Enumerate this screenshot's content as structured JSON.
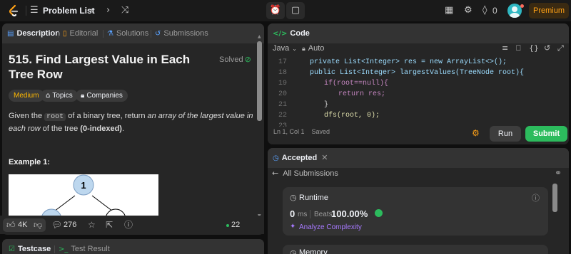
{
  "topnav": {
    "problem_list": "Problem List",
    "streak_count": "0",
    "premium": "Premium",
    "icons": [
      "leetcode-logo",
      "list-icon",
      "chevron-left-icon",
      "chevron-right-icon",
      "shuffle-icon",
      "alarm-icon",
      "note-icon",
      "grid-icon",
      "gear-icon",
      "fire-icon",
      "avatar"
    ]
  },
  "description_panel": {
    "tabs": [
      {
        "label": "Description",
        "active": true,
        "icon": "doc-icon"
      },
      {
        "label": "Editorial",
        "active": false,
        "icon": "book-icon"
      },
      {
        "label": "Solutions",
        "active": false,
        "icon": "flask-icon"
      },
      {
        "label": "Submissions",
        "active": false,
        "icon": "history-icon"
      }
    ],
    "title": "515. Find Largest Value in Each Tree Row",
    "status": "Solved",
    "difficulty": "Medium",
    "topics_label": "Topics",
    "companies_label": "Companies",
    "text_pre": "Given the ",
    "text_code": "root",
    "text_mid": " of a binary tree, return ",
    "text_em": "an array of the largest value in each row",
    "text_post": " of the tree ",
    "text_bold": "(0-indexed)",
    "text_end": ".",
    "example_title": "Example 1:",
    "tree_root_value": "1",
    "likes": "4K",
    "comments": "276",
    "online": "22 Online"
  },
  "code_panel": {
    "title": "Code",
    "language": "Java",
    "mode": "Auto",
    "lines": [
      {
        "num": "17",
        "text": "private List<Integer> res = new ArrayList<>();"
      },
      {
        "num": "18",
        "text": "public List<Integer> largestValues(TreeNode root){"
      },
      {
        "num": "19",
        "text": "if(root==null){"
      },
      {
        "num": "20",
        "text": "return res;"
      },
      {
        "num": "21",
        "text": "}"
      },
      {
        "num": "22",
        "text": "dfs(root, 0);"
      },
      {
        "num": "23",
        "text": ""
      }
    ],
    "cursor": "Ln 1, Col 1",
    "saved": "Saved",
    "run": "Run",
    "submit": "Submit"
  },
  "result_panel": {
    "tab_label": "Accepted",
    "back_label": "All Submissions",
    "runtime_label": "Runtime",
    "runtime_value": "0",
    "runtime_unit": "ms",
    "beats_label": "Beats",
    "beats_value": "100.00%",
    "analyze_label": "Analyze Complexity",
    "memory_label": "Memory"
  },
  "bottom_panel": {
    "testcase": "Testcase",
    "test_result": "Test Result"
  },
  "colors": {
    "accent": "#ffa116",
    "success": "#2cbb5d",
    "medium": "#ffb800",
    "background": "#0f0f0f",
    "panel": "#262626"
  }
}
